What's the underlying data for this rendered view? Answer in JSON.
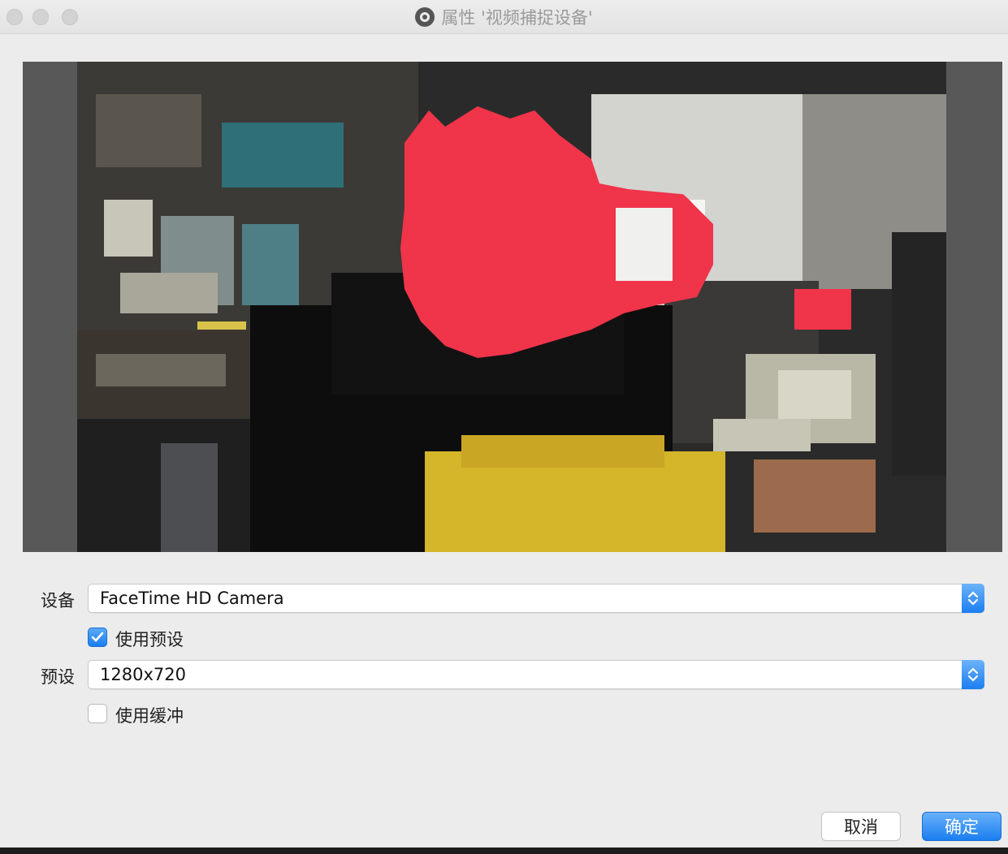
{
  "window": {
    "title": "属性 '视频捕捉设备'",
    "app_icon": "obs-icon"
  },
  "preview": {
    "icon": "camera-preview-image"
  },
  "device": {
    "label": "设备",
    "value": "FaceTime HD Camera"
  },
  "use_preset": {
    "label": "使用预设",
    "checked": true
  },
  "preset": {
    "label": "预设",
    "value": "1280x720"
  },
  "use_buffer": {
    "label": "使用缓冲",
    "checked": false
  },
  "buttons": {
    "cancel": "取消",
    "ok": "确定"
  },
  "colors": {
    "accent": "#1a7ef0",
    "redaction": "#f0344a"
  }
}
